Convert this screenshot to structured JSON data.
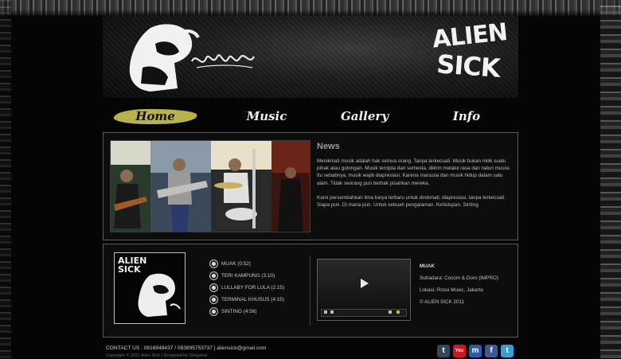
{
  "header": {
    "brand_line1": "ALIEN",
    "brand_line2": "SICK",
    "logo_script": "sinting"
  },
  "nav": {
    "home": "Home",
    "music": "Music",
    "gallery": "Gallery",
    "info": "Info",
    "active": "Home",
    "active_color": "#b7b34a"
  },
  "news": {
    "title": "News",
    "paragraph1": "Menikmati musik adalah hak semua orang. Tanpa terkecuali. Musik bukan milik suatu pihak atau golongan. Musik tercipta dari semesta, dilirim melalui rasa dan naluri musisi. Itu sebabnya, musik wajib diapresiasi. Karena manusia dan musik hidup dalam satu alam. Tidak seorang pun berhak pisahkan mereka.",
    "paragraph2": "Kami persembahkan lima karya terbaru untuk dinikmati, diapresiasi, tanpa terkecuali. Siapa pun. Di mana pun. Untuk sebuah pengalaman. Kehidupan. Sinting."
  },
  "album": {
    "cover_line1": "ALIEN",
    "cover_line2": "SICK"
  },
  "tracks": [
    "MUAK (0:52)",
    "TERI KAMPUNG (3:10)",
    "LULLABY FOR LULA (2:15)",
    "TERMINAL KHUSUS (4:15)",
    "SINTING (4:56)"
  ],
  "now_playing": {
    "title": "MUAK",
    "line1": "Sutradara: Cocom & Doro (IMPRO)",
    "line2": "Lokasi: Rossi Music, Jakarta",
    "line3": "© ALIEN SICK 2011"
  },
  "footer": {
    "contact": "CONTACT US : 0816948437 / 083895753737 | aliensick@gmail.com",
    "copyright": "Copyright © 2011 Alien Sick | Designed by Slingshot"
  },
  "social": [
    {
      "icon": "tumblr-icon",
      "glyph": "t",
      "color": "#35465c"
    },
    {
      "icon": "youtube-icon",
      "glyph": "You",
      "color": "#cc181e"
    },
    {
      "icon": "myspace-icon",
      "glyph": "m",
      "color": "#2a5caa"
    },
    {
      "icon": "facebook-icon",
      "glyph": "f",
      "color": "#3b5998"
    },
    {
      "icon": "twitter-icon",
      "glyph": "t",
      "color": "#33a1d8"
    }
  ]
}
